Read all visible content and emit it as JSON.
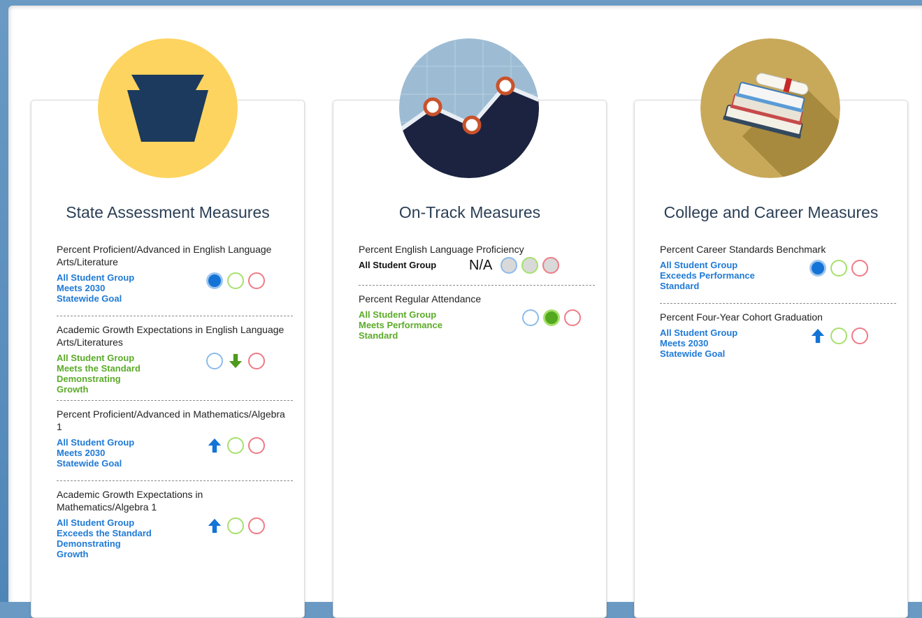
{
  "colors": {
    "link_blue": "#1f7ad6",
    "status_green": "#5cab29",
    "ring_blue": "#8cbcea",
    "ring_green": "#a6e06d",
    "ring_red": "#ef7b86",
    "emblem_yellow": "#fdd45f",
    "emblem_navy": "#1b3a5e",
    "emblem_gold": "#c8a95a"
  },
  "cards": [
    {
      "title": "State Assessment Measures",
      "icon": "keystone-icon",
      "measures": [
        {
          "title": "Percent Proficient/Advanced in English Language Arts/Literature",
          "status_lines": [
            "All Student Group",
            "Meets 2030",
            "Statewide Goal"
          ],
          "status_color": "blue",
          "indicators": [
            "filled-blue",
            "ring-green",
            "ring-red"
          ]
        },
        {
          "title": "Academic Growth Expectations in English Language Arts/Literatures",
          "status_lines": [
            "All Student Group",
            "Meets the Standard",
            "Demonstrating",
            "Growth"
          ],
          "status_color": "green",
          "indicators": [
            "ring-blue",
            "arrow-down-green",
            "ring-red"
          ]
        },
        {
          "title": "Percent Proficient/Advanced in Mathematics/Algebra 1",
          "status_lines": [
            "All Student Group",
            "Meets 2030",
            "Statewide Goal"
          ],
          "status_color": "blue",
          "indicators": [
            "arrow-up-blue",
            "ring-green",
            "ring-red"
          ]
        },
        {
          "title": "Academic Growth Expectations in Mathematics/Algebra 1",
          "status_lines": [
            "All Student Group",
            "Exceeds the Standard",
            "Demonstrating",
            "Growth"
          ],
          "status_color": "blue",
          "indicators": [
            "arrow-up-blue",
            "ring-green",
            "ring-red"
          ]
        }
      ]
    },
    {
      "title": "On-Track Measures",
      "icon": "line-chart-icon",
      "measures": [
        {
          "title": "Percent English Language Proficiency",
          "status_lines": [
            "All Student Group"
          ],
          "status_color": "black",
          "na_label": "N/A",
          "indicators": [
            "gray-blue",
            "gray-green",
            "gray-red"
          ]
        },
        {
          "title": "Percent Regular Attendance",
          "status_lines": [
            "All Student Group",
            "Meets Performance",
            "Standard"
          ],
          "status_color": "green",
          "indicators": [
            "ring-blue",
            "filled-green",
            "ring-red"
          ]
        }
      ]
    },
    {
      "title": "College and Career Measures",
      "icon": "books-diploma-icon",
      "measures": [
        {
          "title": "Percent Career Standards Benchmark",
          "status_lines": [
            "All Student Group",
            "Exceeds Performance",
            "Standard"
          ],
          "status_color": "blue",
          "indicators": [
            "filled-blue",
            "ring-green",
            "ring-red"
          ]
        },
        {
          "title": "Percent Four-Year Cohort Graduation",
          "status_lines": [
            "All Student Group",
            "Meets 2030",
            "Statewide Goal"
          ],
          "status_color": "blue",
          "indicators": [
            "arrow-up-blue",
            "ring-green",
            "ring-red"
          ]
        }
      ]
    }
  ]
}
